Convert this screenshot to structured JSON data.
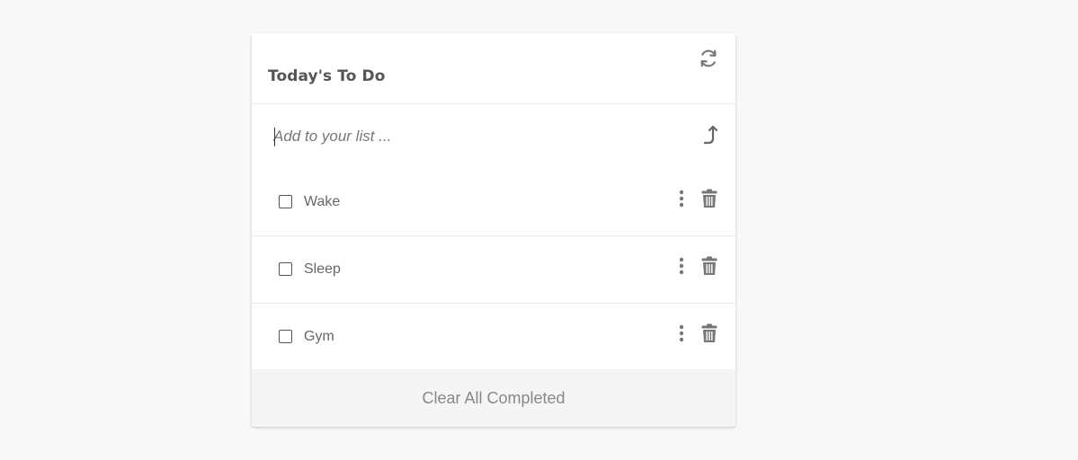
{
  "header": {
    "title": "Today's To Do",
    "refresh_icon": "refresh-icon"
  },
  "add": {
    "placeholder": "Add to your list ...",
    "value": "",
    "submit_icon": "arrow-up-turn-icon"
  },
  "todos": [
    {
      "label": "Wake",
      "completed": false
    },
    {
      "label": "Sleep",
      "completed": false
    },
    {
      "label": "Gym",
      "completed": false
    }
  ],
  "item_icons": {
    "menu": "more-vertical-icon",
    "delete": "trash-icon"
  },
  "footer": {
    "clear_label": "Clear All Completed"
  },
  "colors": {
    "background": "#f8f8f8",
    "card": "#ffffff",
    "title": "#555555",
    "icon": "#777777",
    "footer_bg": "#f5f5f5",
    "footer_text": "#888888"
  }
}
